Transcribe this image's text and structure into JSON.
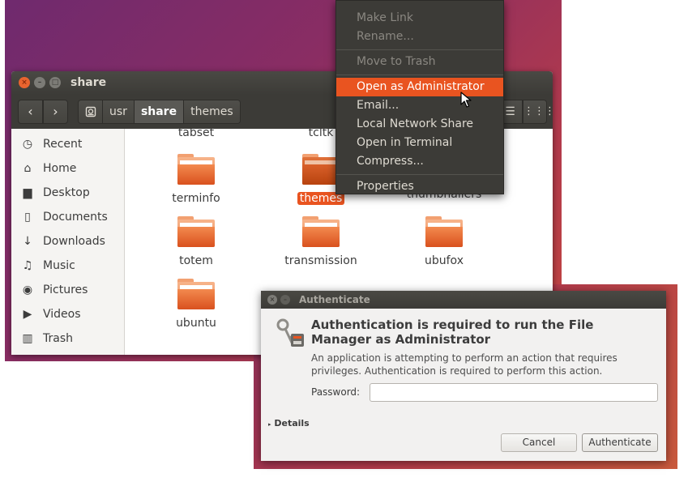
{
  "file_manager": {
    "title": "share",
    "breadcrumbs": [
      "usr",
      "share",
      "themes"
    ],
    "active_crumb": "share",
    "sidebar": [
      {
        "label": "Recent",
        "icon": "clock-icon"
      },
      {
        "label": "Home",
        "icon": "home-icon"
      },
      {
        "label": "Desktop",
        "icon": "folder-icon"
      },
      {
        "label": "Documents",
        "icon": "document-icon"
      },
      {
        "label": "Downloads",
        "icon": "download-icon"
      },
      {
        "label": "Music",
        "icon": "music-icon"
      },
      {
        "label": "Pictures",
        "icon": "camera-icon"
      },
      {
        "label": "Videos",
        "icon": "video-icon"
      },
      {
        "label": "Trash",
        "icon": "trash-icon"
      }
    ],
    "partial_labels": [
      "tabset",
      "tcltk",
      "thumbnailers"
    ],
    "files": [
      {
        "name": "terminfo"
      },
      {
        "name": "themes",
        "selected": true
      },
      {
        "name": "totem"
      },
      {
        "name": "transmission"
      },
      {
        "name": "ubufox"
      },
      {
        "name": "ubuntu"
      }
    ]
  },
  "context_menu": {
    "items": [
      {
        "label": "Make Link",
        "disabled": true
      },
      {
        "label": "Rename...",
        "disabled": true
      },
      {
        "label": "Move to Trash",
        "disabled": true
      },
      {
        "label": "Open as Administrator",
        "highlighted": true
      },
      {
        "label": "Email..."
      },
      {
        "label": "Local Network Share"
      },
      {
        "label": "Open in Terminal"
      },
      {
        "label": "Compress..."
      },
      {
        "label": "Properties"
      }
    ]
  },
  "auth_dialog": {
    "title": "Authenticate",
    "heading": "Authentication is required to run the File Manager as Administrator",
    "message": "An application is attempting to perform an action that requires privileges. Authentication is required to perform this action.",
    "password_label": "Password:",
    "password_value": "",
    "details_label": "Details",
    "cancel_label": "Cancel",
    "authenticate_label": "Authenticate"
  },
  "colors": {
    "accent": "#e95420",
    "title_bar": "#3c3b37",
    "menu_bg": "#3c3b37"
  }
}
